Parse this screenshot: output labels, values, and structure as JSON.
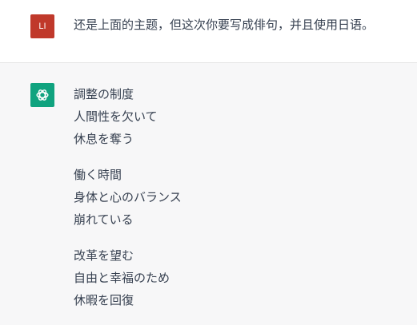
{
  "user_message": {
    "avatar_initials": "LI",
    "text": "还是上面的主题，但这次你要写成俳句，并且使用日语。"
  },
  "assistant_message": {
    "avatar_icon": "openai-logo-icon",
    "stanzas": [
      {
        "lines": [
          "調整の制度",
          "人間性を欠いて",
          "休息を奪う"
        ]
      },
      {
        "lines": [
          "働く時間",
          "身体と心のバランス",
          "崩れている"
        ]
      },
      {
        "lines": [
          "改革を望む",
          "自由と幸福のため",
          "休暇を回復"
        ]
      }
    ]
  },
  "colors": {
    "user_avatar_bg": "#c0392b",
    "assistant_avatar_bg": "#10a37f",
    "assistant_row_bg": "#f7f7f8",
    "text": "#374151"
  }
}
